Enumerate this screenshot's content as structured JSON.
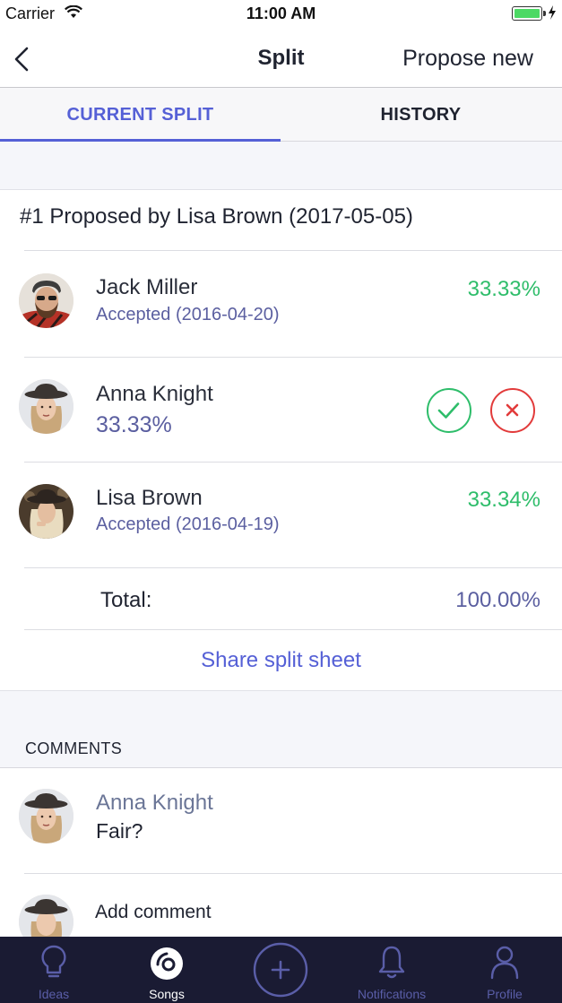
{
  "status_bar": {
    "carrier": "Carrier",
    "time": "11:00 AM"
  },
  "nav": {
    "title": "Split",
    "right_action": "Propose new"
  },
  "tabs": [
    {
      "label": "CURRENT SPLIT"
    },
    {
      "label": "HISTORY"
    }
  ],
  "proposal": {
    "title": "#1 Proposed by Lisa Brown (2017-05-05)"
  },
  "members": [
    {
      "name": "Jack Miller",
      "status": "Accepted (2016-04-20)",
      "percent": "33.33%"
    },
    {
      "name": "Anna Knight",
      "percent": "33.33%"
    },
    {
      "name": "Lisa Brown",
      "status": "Accepted (2016-04-19)",
      "percent": "33.34%"
    }
  ],
  "total": {
    "label": "Total:",
    "value": "100.00%"
  },
  "share_link": "Share split sheet",
  "comments": {
    "section_label": "COMMENTS",
    "items": [
      {
        "author": "Anna Knight",
        "text": "Fair?"
      }
    ],
    "add_placeholder": "Add comment"
  },
  "tab_bar": [
    {
      "label": "Ideas",
      "icon": "lightbulb-icon"
    },
    {
      "label": "Songs",
      "icon": "disc-icon"
    },
    {
      "label": "",
      "icon": "plus-icon"
    },
    {
      "label": "Notifications",
      "icon": "bell-icon"
    },
    {
      "label": "Profile",
      "icon": "person-icon"
    }
  ],
  "colors": {
    "accent": "#5560d6",
    "accepted_green": "#2ebd6a",
    "reject_red": "#e23b3b",
    "tab_bar_bg": "#1a1b33"
  }
}
